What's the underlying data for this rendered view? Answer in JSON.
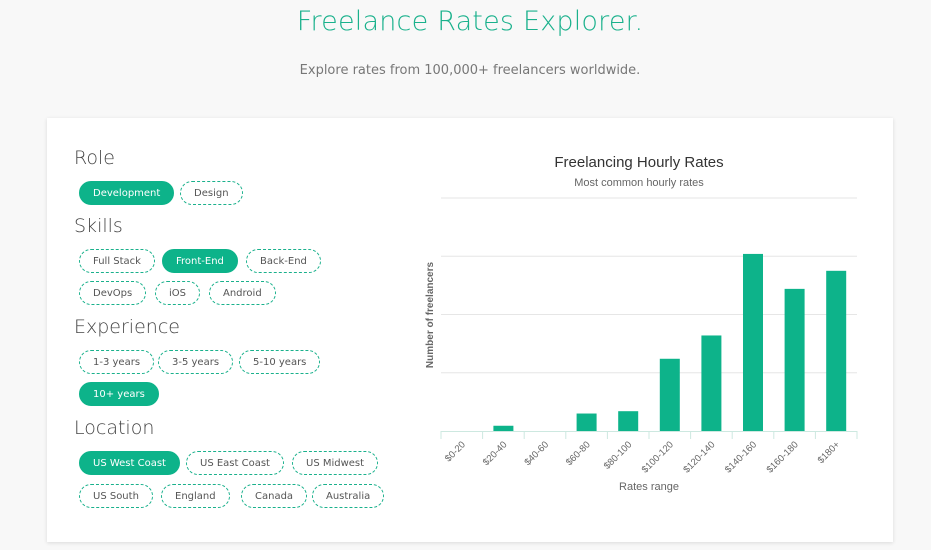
{
  "header": {
    "title": "Freelance Rates Explorer.",
    "subtitle": "Explore rates from 100,000+ freelancers worldwide."
  },
  "filters": {
    "role": {
      "heading": "Role",
      "options": [
        {
          "label": "Development",
          "active": true
        },
        {
          "label": "Design",
          "active": false
        }
      ]
    },
    "skills": {
      "heading": "Skills",
      "options": [
        {
          "label": "Full Stack",
          "active": false
        },
        {
          "label": "Front-End",
          "active": true
        },
        {
          "label": "Back-End",
          "active": false
        },
        {
          "label": "DevOps",
          "active": false
        },
        {
          "label": "iOS",
          "active": false
        },
        {
          "label": "Android",
          "active": false
        }
      ]
    },
    "experience": {
      "heading": "Experience",
      "options": [
        {
          "label": "1-3 years",
          "active": false
        },
        {
          "label": "3-5 years",
          "active": false
        },
        {
          "label": "5-10 years",
          "active": false
        },
        {
          "label": "10+ years",
          "active": true
        }
      ]
    },
    "location": {
      "heading": "Location",
      "options": [
        {
          "label": "US West Coast",
          "active": true
        },
        {
          "label": "US East Coast",
          "active": false
        },
        {
          "label": "US Midwest",
          "active": false
        },
        {
          "label": "US South",
          "active": false
        },
        {
          "label": "England",
          "active": false
        },
        {
          "label": "Canada",
          "active": false
        },
        {
          "label": "Australia",
          "active": false
        }
      ]
    }
  },
  "colors": {
    "accent": "#1ab18c",
    "bar": "#0db38a",
    "chip_active": "#0db38a"
  },
  "chart_data": {
    "type": "bar",
    "title": "Freelancing Hourly Rates",
    "subtitle": "Most common hourly rates",
    "xlabel": "Rates range",
    "ylabel": "Number of freelancers",
    "categories": [
      "$0-20",
      "$20-40",
      "$40-60",
      "$60-80",
      "$80-100",
      "$100-120",
      "$120-140",
      "$140-160",
      "$160-180",
      "$180+"
    ],
    "values": [
      0,
      0.09,
      0,
      0.3,
      0.34,
      1.24,
      1.64,
      3.04,
      2.44,
      2.75
    ],
    "ylim": [
      0,
      4
    ],
    "y_gridlines": [
      1,
      2,
      3,
      4
    ],
    "y_tick_labels_shown": false,
    "grid": true,
    "legend": "none"
  }
}
